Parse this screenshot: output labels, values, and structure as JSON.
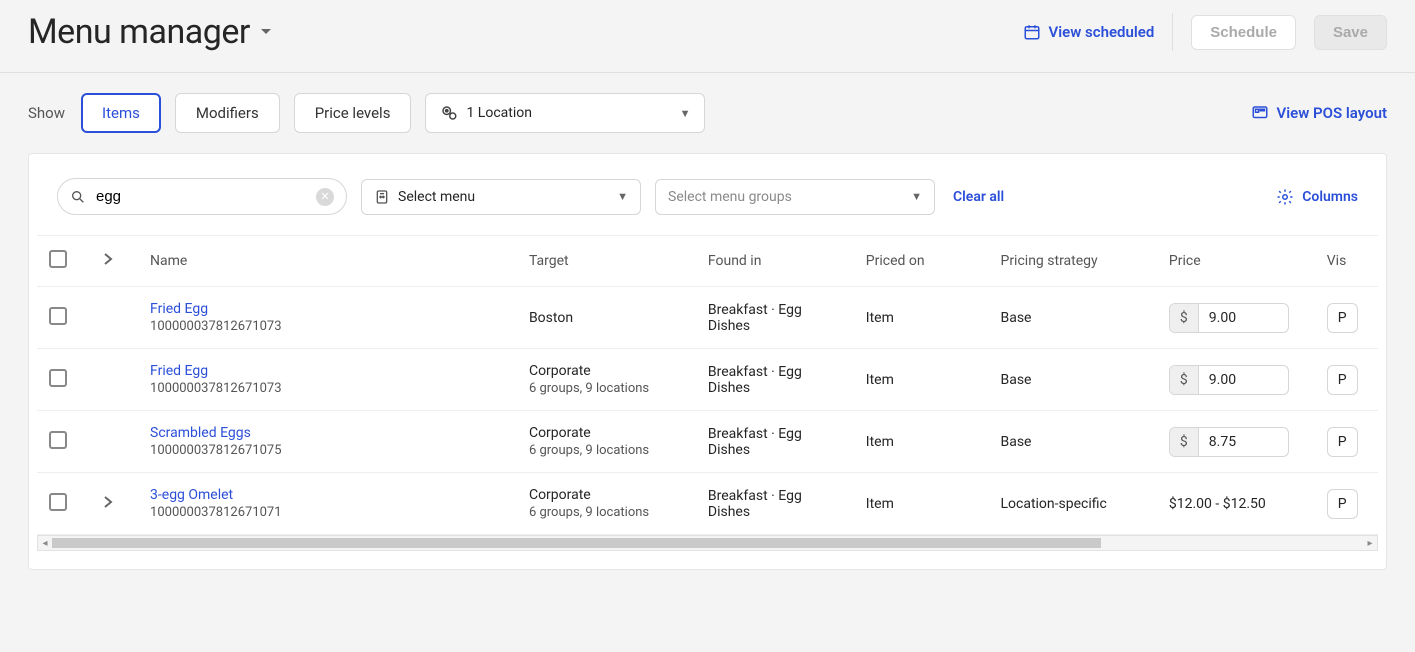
{
  "header": {
    "title": "Menu manager",
    "view_scheduled": "View scheduled",
    "schedule_btn": "Schedule",
    "save_btn": "Save"
  },
  "toolbar": {
    "show_label": "Show",
    "tabs": {
      "items": "Items",
      "modifiers": "Modifiers",
      "price_levels": "Price levels"
    },
    "location_dropdown": "1 Location",
    "view_pos": "View POS layout"
  },
  "filters": {
    "search_value": "egg",
    "select_menu": "Select menu",
    "select_groups_placeholder": "Select menu groups",
    "clear_all": "Clear all",
    "columns_btn": "Columns"
  },
  "table": {
    "headers": {
      "name": "Name",
      "target": "Target",
      "found_in": "Found in",
      "priced_on": "Priced on",
      "strategy": "Pricing strategy",
      "price": "Price",
      "vis": "Vis"
    },
    "rows": [
      {
        "name": "Fried Egg",
        "sku": "100000037812671073",
        "target": "Boston",
        "target_sub": "",
        "found_in": "Breakfast · Egg Dishes",
        "priced_on": "Item",
        "strategy": "Base",
        "price_value": "9.00",
        "price_range": "",
        "vis_chip": "P",
        "expandable": false
      },
      {
        "name": "Fried Egg",
        "sku": "100000037812671073",
        "target": "Corporate",
        "target_sub": "6 groups, 9 locations",
        "found_in": "Breakfast · Egg Dishes",
        "priced_on": "Item",
        "strategy": "Base",
        "price_value": "9.00",
        "price_range": "",
        "vis_chip": "P",
        "expandable": false
      },
      {
        "name": "Scrambled Eggs",
        "sku": "100000037812671075",
        "target": "Corporate",
        "target_sub": "6 groups, 9 locations",
        "found_in": "Breakfast · Egg Dishes",
        "priced_on": "Item",
        "strategy": "Base",
        "price_value": "8.75",
        "price_range": "",
        "vis_chip": "P",
        "expandable": false
      },
      {
        "name": "3-egg Omelet",
        "sku": "100000037812671071",
        "target": "Corporate",
        "target_sub": "6 groups, 9 locations",
        "found_in": "Breakfast · Egg Dishes",
        "priced_on": "Item",
        "strategy": "Location-specific",
        "price_value": "",
        "price_range": "$12.00 - $12.50",
        "vis_chip": "P",
        "expandable": true
      }
    ]
  }
}
